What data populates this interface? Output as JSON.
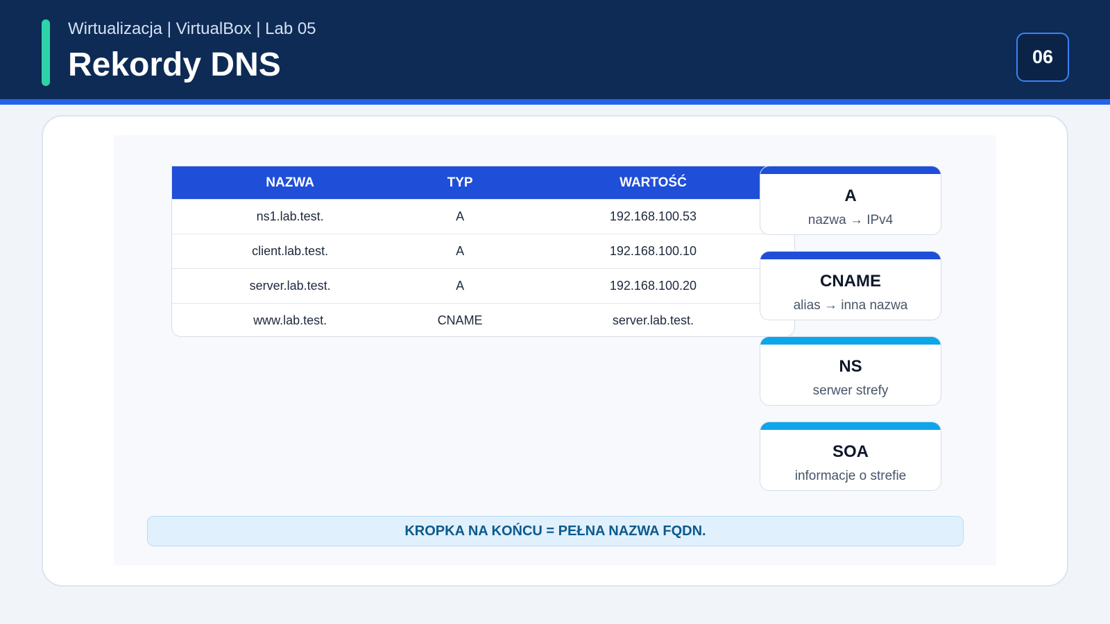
{
  "header": {
    "subtitle": "Wirtualizacja | VirtualBox | Lab 05",
    "title": "Rekordy DNS",
    "page_number": "06"
  },
  "table": {
    "columns": [
      "NAZWA",
      "TYP",
      "WARTOŚĆ"
    ],
    "rows": [
      [
        "ns1.lab.test.",
        "A",
        "192.168.100.53"
      ],
      [
        "client.lab.test.",
        "A",
        "192.168.100.10"
      ],
      [
        "server.lab.test.",
        "A",
        "192.168.100.20"
      ],
      [
        "www.lab.test.",
        "CNAME",
        "server.lab.test."
      ]
    ]
  },
  "record_types": [
    {
      "title": "A",
      "desc": "nazwa → IPv4",
      "color": "#1f4ed8"
    },
    {
      "title": "CNAME",
      "desc": "alias → inna nazwa",
      "color": "#1f4ed8"
    },
    {
      "title": "NS",
      "desc": "serwer strefy",
      "color": "#0ea5e9"
    },
    {
      "title": "SOA",
      "desc": "informacje o strefie",
      "color": "#0ea5e9"
    }
  ],
  "note": "KROPKA NA KOŃCU = PEŁNA NAZWA FQDN.",
  "colors": {
    "header_bg": "#0d2b55",
    "accent": "#2dd4a8",
    "table_header": "#1f4ed8"
  }
}
